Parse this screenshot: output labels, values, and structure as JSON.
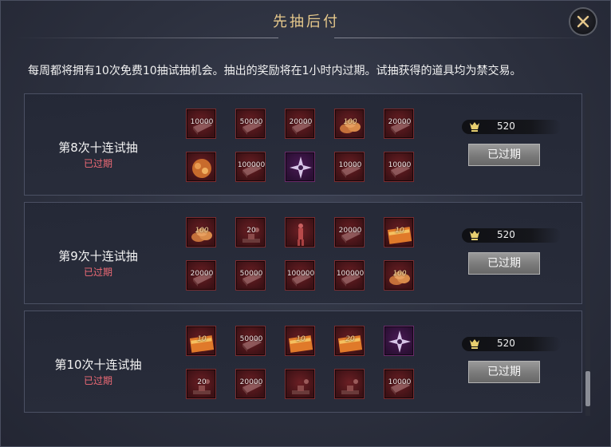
{
  "dialog": {
    "title": "先抽后付",
    "close_icon": "close-x-icon",
    "description": "每周都将拥有10次免费10抽试抽机会。抽出的奖励将在1小时内过期。试抽获得的道具均为禁交易。"
  },
  "colors": {
    "title": "#e7c98c",
    "status_expired": "#ef6b76",
    "slot_border": "#7a2b2f",
    "button_gray": "#8a8a8a"
  },
  "draws": [
    {
      "name": "第8次十连试抽",
      "status": "已过期",
      "cost_icon": "currency-token-icon",
      "cost": "520",
      "button": "已过期",
      "items": [
        {
          "icon": "silver-ingot-icon",
          "amount": "10000",
          "style": "red"
        },
        {
          "icon": "silver-ingot-icon",
          "amount": "50000",
          "style": "red"
        },
        {
          "icon": "silver-ingot-icon",
          "amount": "20000",
          "style": "red"
        },
        {
          "icon": "coin-pile-icon",
          "amount": "100",
          "style": "orange"
        },
        {
          "icon": "silver-ingot-icon",
          "amount": "20000",
          "style": "red"
        },
        {
          "icon": "treasure-bag-icon",
          "amount": "",
          "style": "red"
        },
        {
          "icon": "silver-ingot-icon",
          "amount": "100000",
          "style": "red"
        },
        {
          "icon": "shuriken-icon",
          "amount": "",
          "style": "purple"
        },
        {
          "icon": "silver-ingot-icon",
          "amount": "10000",
          "style": "red"
        },
        {
          "icon": "silver-ingot-icon",
          "amount": "10000",
          "style": "red"
        }
      ]
    },
    {
      "name": "第9次十连试抽",
      "status": "已过期",
      "cost_icon": "currency-token-icon",
      "cost": "520",
      "button": "已过期",
      "items": [
        {
          "icon": "coin-pile-icon",
          "amount": "100",
          "style": "orange"
        },
        {
          "icon": "anvil-icon",
          "amount": "20",
          "style": "red"
        },
        {
          "icon": "figure-icon",
          "amount": "",
          "style": "red"
        },
        {
          "icon": "silver-ingot-icon",
          "amount": "20000",
          "style": "red"
        },
        {
          "icon": "ticket-bundle-icon",
          "amount": "10",
          "style": "orange"
        },
        {
          "icon": "silver-ingot-icon",
          "amount": "20000",
          "style": "red"
        },
        {
          "icon": "silver-ingot-icon",
          "amount": "50000",
          "style": "red"
        },
        {
          "icon": "silver-ingot-icon",
          "amount": "100000",
          "style": "red"
        },
        {
          "icon": "silver-ingot-icon",
          "amount": "100000",
          "style": "red"
        },
        {
          "icon": "coin-pile-icon",
          "amount": "100",
          "style": "orange"
        }
      ]
    },
    {
      "name": "第10次十连试抽",
      "status": "已过期",
      "cost_icon": "currency-token-icon",
      "cost": "520",
      "button": "已过期",
      "items": [
        {
          "icon": "ticket-bundle-icon",
          "amount": "10",
          "style": "orange"
        },
        {
          "icon": "silver-ingot-icon",
          "amount": "50000",
          "style": "red"
        },
        {
          "icon": "ticket-bundle-icon",
          "amount": "10",
          "style": "orange"
        },
        {
          "icon": "ticket-bundle-icon",
          "amount": "20",
          "style": "orange"
        },
        {
          "icon": "shuriken-icon",
          "amount": "",
          "style": "purple"
        },
        {
          "icon": "anvil-icon",
          "amount": "20",
          "style": "red"
        },
        {
          "icon": "silver-ingot-icon",
          "amount": "20000",
          "style": "red"
        },
        {
          "icon": "anvil-icon",
          "amount": "",
          "style": "red"
        },
        {
          "icon": "anvil-icon",
          "amount": "",
          "style": "red"
        },
        {
          "icon": "silver-ingot-icon",
          "amount": "10000",
          "style": "red"
        }
      ]
    }
  ]
}
